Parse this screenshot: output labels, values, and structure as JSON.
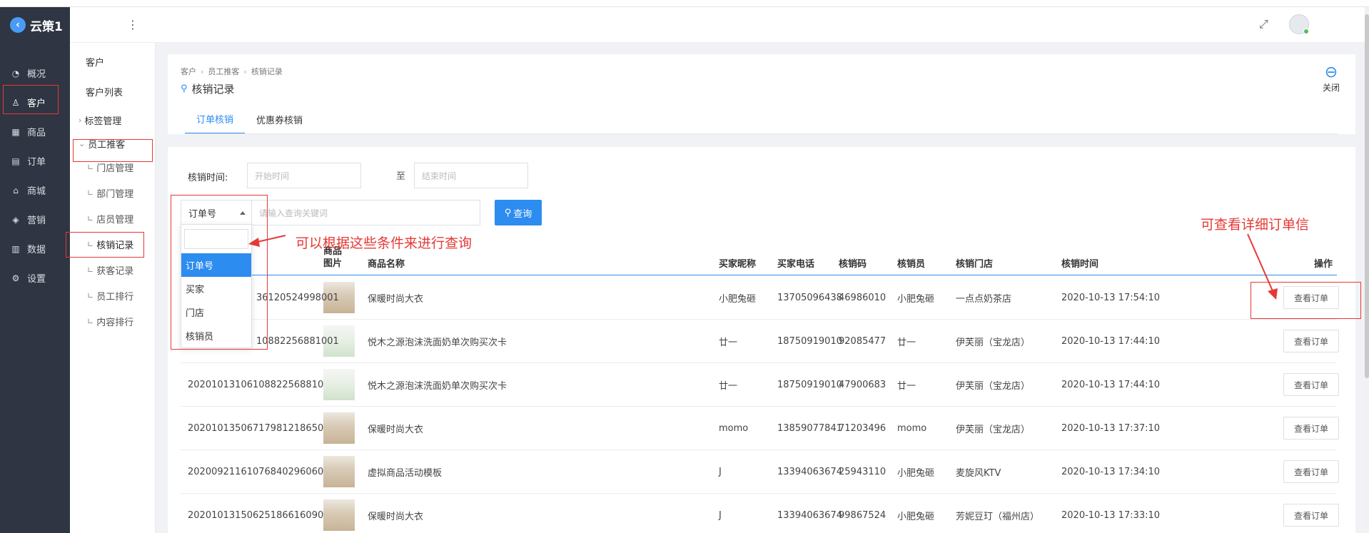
{
  "app": {
    "name": "云策1"
  },
  "sidebar": {
    "items": [
      {
        "label": "概况",
        "icon": "dashboard-icon"
      },
      {
        "label": "客户",
        "icon": "user-icon"
      },
      {
        "label": "商品",
        "icon": "grid-icon"
      },
      {
        "label": "订单",
        "icon": "calendar-icon"
      },
      {
        "label": "商城",
        "icon": "shop-icon"
      },
      {
        "label": "营销",
        "icon": "tag-icon"
      },
      {
        "label": "数据",
        "icon": "bar-chart-icon"
      },
      {
        "label": "设置",
        "icon": "gear-icon"
      }
    ]
  },
  "submenu": {
    "title": "客户",
    "list": "客户列表",
    "tags": "标签管理",
    "employee": "员工推客",
    "children": [
      "门店管理",
      "部门管理",
      "店员管理",
      "核销记录",
      "获客记录",
      "员工排行",
      "内容排行"
    ]
  },
  "breadcrumb": [
    "客户",
    "员工推客",
    "核销记录"
  ],
  "page_title": "核销记录",
  "close_label": "关闭",
  "tabs": [
    "订单核销",
    "优惠券核销"
  ],
  "filters": {
    "time_label": "核销时间:",
    "start_placeholder": "开始时间",
    "to_label": "至",
    "end_placeholder": "结束时间",
    "select_value": "订单号",
    "keyword_placeholder": "请输入查询关键词",
    "search_label": "查询"
  },
  "dropdown_options": [
    "订单号",
    "买家",
    "门店",
    "核销员"
  ],
  "table": {
    "headers": {
      "img_line1": "商品",
      "img_line2": "图片",
      "name": "商品名称",
      "buyer": "买家昵称",
      "phone": "买家电话",
      "code": "核销码",
      "staff": "核销员",
      "store": "核销门店",
      "time": "核销时间",
      "ops": "操作"
    },
    "rows": [
      {
        "order": "36120524998001",
        "img": "coat",
        "name": "保暖时尚大衣",
        "buyer": "小肥兔砸",
        "phone": "13705096438",
        "code": "46986010",
        "staff": "小肥兔砸",
        "store": "一点点奶茶店",
        "time": "2020-10-13 17:54:10"
      },
      {
        "order": "10882256881001",
        "img": "card",
        "name": "悦木之源泡沫洗面奶单次购买次卡",
        "buyer": "廿一",
        "phone": "18750919010",
        "code": "92085477",
        "staff": "廿一",
        "store": "伊芙丽（宝龙店）",
        "time": "2020-10-13 17:44:10"
      },
      {
        "order": "20201013106108822568810​01",
        "img": "card",
        "name": "悦木之源泡沫洗面奶单次购买次卡",
        "buyer": "廿一",
        "phone": "18750919010",
        "code": "47900683",
        "staff": "廿一",
        "store": "伊芙丽（宝龙店）",
        "time": "2020-10-13 17:44:10"
      },
      {
        "order": "20201013506717981218650​01",
        "img": "coat",
        "name": "保暖时尚大衣",
        "buyer": "momo",
        "phone": "13859077841",
        "code": "71203496",
        "staff": "momo",
        "store": "伊芙丽（宝龙店）",
        "time": "2020-10-13 17:37:10"
      },
      {
        "order": "20200921161076840296060​01",
        "img": "coat",
        "name": "虚拟商品活动模板",
        "buyer": "J",
        "phone": "13394063674",
        "code": "25943110",
        "staff": "小肥兔砸",
        "store": "麦旋风KTV",
        "time": "2020-10-13 17:34:10"
      },
      {
        "order": "20201013150625186616090​01",
        "img": "coat",
        "name": "保暖时尚大衣",
        "buyer": "J",
        "phone": "13394063674",
        "code": "99867524",
        "staff": "小肥兔砸",
        "store": "芳妮豆玎（福州店）",
        "time": "2020-10-13 17:33:10"
      }
    ],
    "action_label": "查看订单"
  },
  "annotations": {
    "left": "可以根据这些条件来进行查询",
    "right": "可查看详细订单信"
  },
  "colors": {
    "accent": "#2d8cf0",
    "sidebar_bg": "#2f3542",
    "annotation": "#e53935"
  }
}
